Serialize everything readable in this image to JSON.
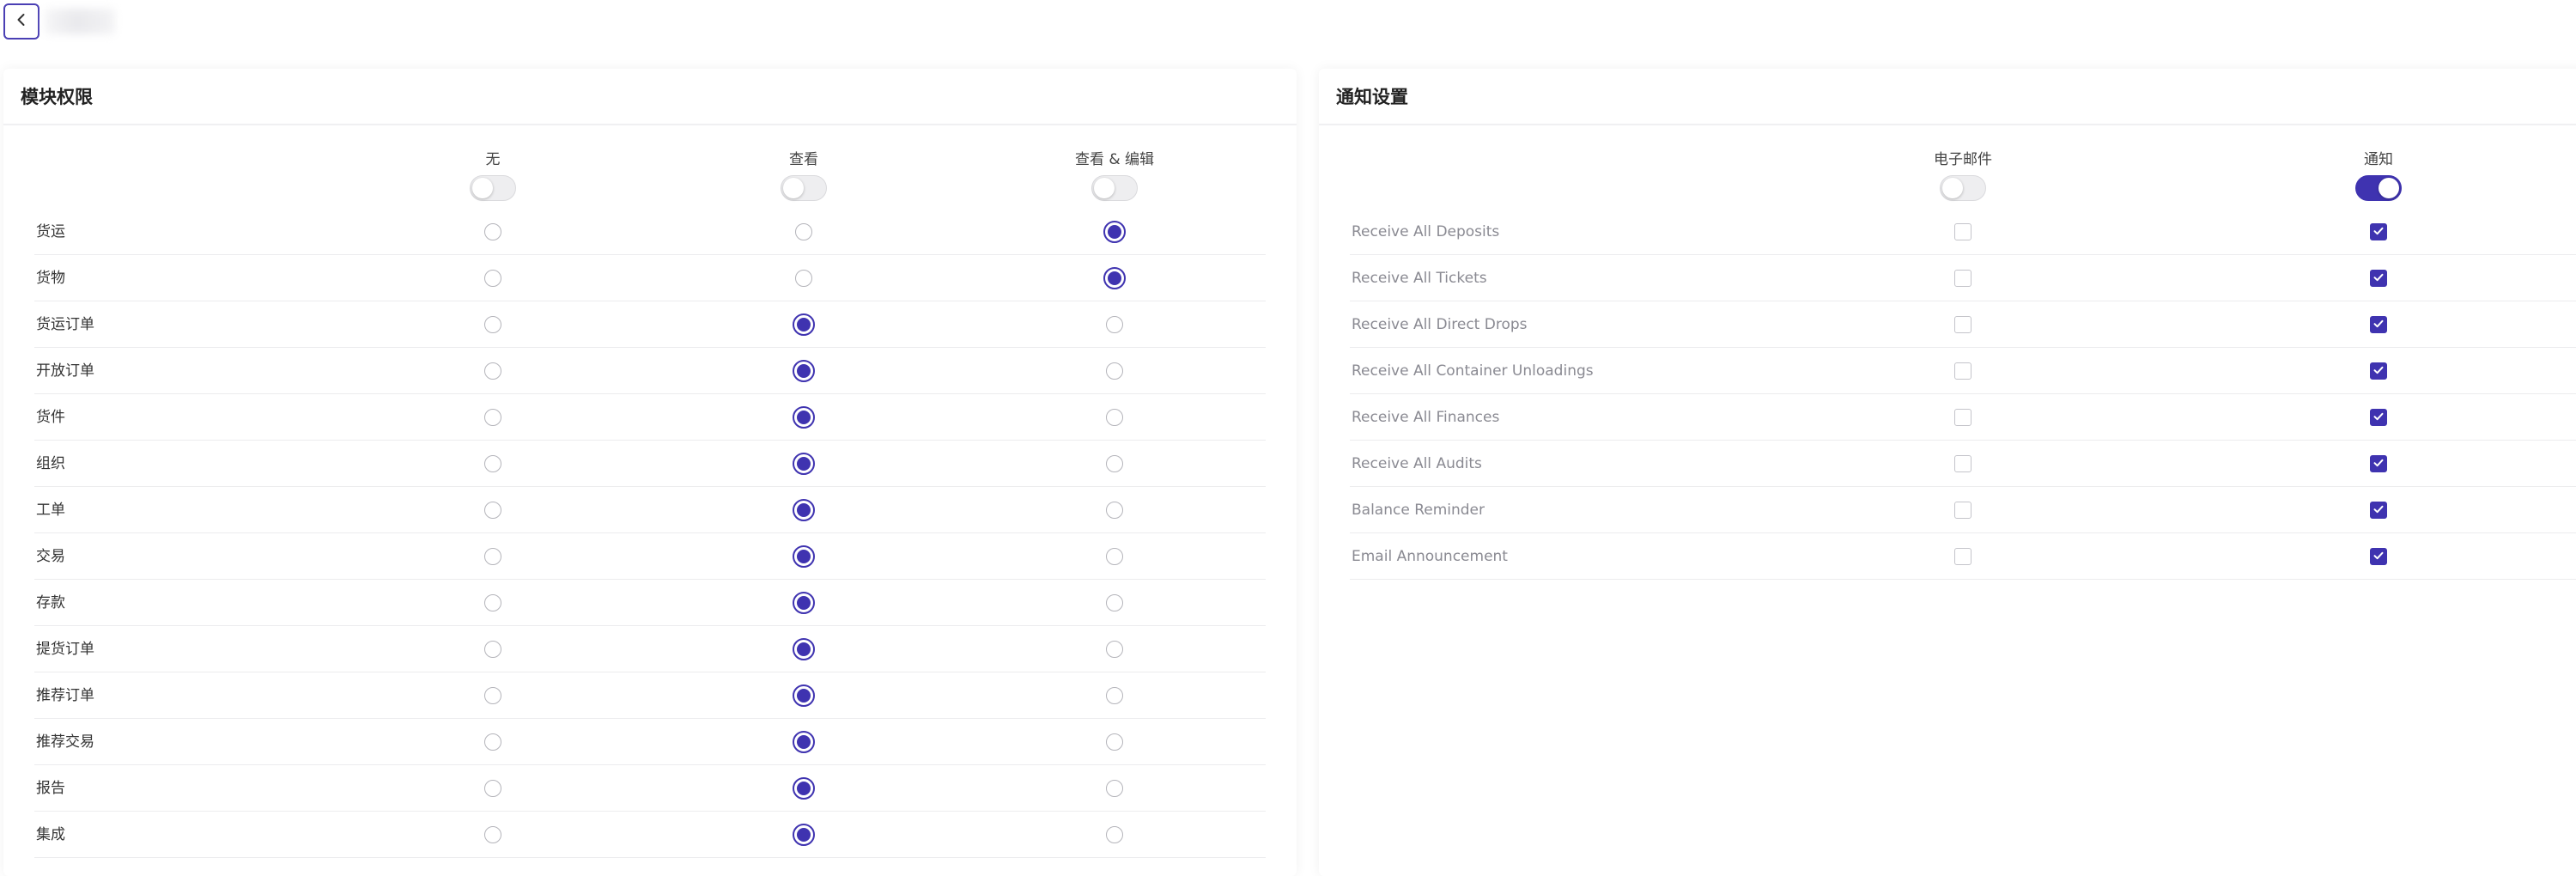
{
  "colors": {
    "accent": "#3f33b0",
    "border": "#ececee",
    "muted_text": "#8a8a92"
  },
  "header": {
    "back_icon": "chevron-left-icon"
  },
  "module_permissions": {
    "title": "模块权限",
    "columns": [
      {
        "label": "无",
        "toggle_on": false
      },
      {
        "label": "查看",
        "toggle_on": false
      },
      {
        "label": "查看 & 编辑",
        "toggle_on": false
      }
    ],
    "rows": [
      {
        "label": "货运",
        "selected": 2
      },
      {
        "label": "货物",
        "selected": 2
      },
      {
        "label": "货运订单",
        "selected": 1
      },
      {
        "label": "开放订单",
        "selected": 1
      },
      {
        "label": "货件",
        "selected": 1
      },
      {
        "label": "组织",
        "selected": 1
      },
      {
        "label": "工单",
        "selected": 1
      },
      {
        "label": "交易",
        "selected": 1
      },
      {
        "label": "存款",
        "selected": 1
      },
      {
        "label": "提货订单",
        "selected": 1
      },
      {
        "label": "推荐订单",
        "selected": 1
      },
      {
        "label": "推荐交易",
        "selected": 1
      },
      {
        "label": "报告",
        "selected": 1
      },
      {
        "label": "集成",
        "selected": 1
      }
    ]
  },
  "notification_settings": {
    "title": "通知设置",
    "columns": [
      {
        "label": "电子邮件",
        "toggle_on": false
      },
      {
        "label": "通知",
        "toggle_on": true
      }
    ],
    "rows": [
      {
        "label": "Receive All Deposits",
        "email": false,
        "notify": true
      },
      {
        "label": "Receive All Tickets",
        "email": false,
        "notify": true
      },
      {
        "label": "Receive All Direct Drops",
        "email": false,
        "notify": true
      },
      {
        "label": "Receive All Container Unloadings",
        "email": false,
        "notify": true
      },
      {
        "label": "Receive All Finances",
        "email": false,
        "notify": true
      },
      {
        "label": "Receive All Audits",
        "email": false,
        "notify": true
      },
      {
        "label": "Balance Reminder",
        "email": false,
        "notify": true
      },
      {
        "label": "Email Announcement",
        "email": false,
        "notify": true
      }
    ]
  }
}
